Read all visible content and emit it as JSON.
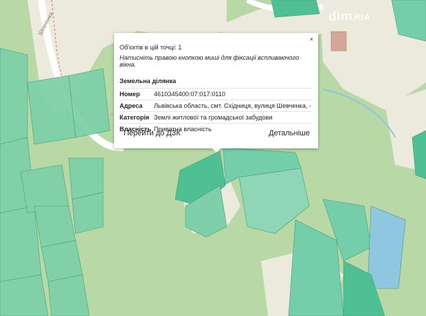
{
  "map": {
    "watermark": "dim",
    "watermark_suffix": "RIA",
    "road_label": "Шевченка",
    "colors": {
      "background": "#b9d9a9",
      "forest": "#a9d093",
      "parcel": "#74ceaa",
      "parcel_dark": "#4fbf94",
      "built": "#ece9dd",
      "road": "#ffffff",
      "path": "#e08060",
      "water": "#8fc6e0"
    }
  },
  "popup": {
    "close_label": "×",
    "objects_count": "Об'єктів в цій точці: 1",
    "hint": "Натисніть правою кнопкою миші для фіксації вспливаючого вікна.",
    "section_title": "Земельна ділянка",
    "rows": [
      {
        "key": "Номер",
        "value": "4610345400:07:017:0110"
      },
      {
        "key": "Адреса",
        "value": "Львівська область, смт. Східниця, вулиця Шевченка, -"
      },
      {
        "key": "Категорія",
        "value": "Землі житлової та громадської забудови"
      },
      {
        "key": "Власність",
        "value": "Приватна власність"
      }
    ],
    "btn_dzk": "Перейти до ДЗК",
    "btn_details": "Детальніше"
  }
}
